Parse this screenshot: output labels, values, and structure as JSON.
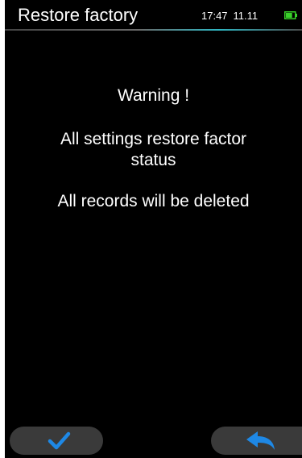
{
  "header": {
    "title": "Restore factory",
    "time": "17:47",
    "date": "11.11"
  },
  "battery": {
    "icon": "battery-icon",
    "color": "#39d12a",
    "level": 0.7
  },
  "message": {
    "warning": "Warning !",
    "line1": "All settings restore factor",
    "line2": "status",
    "line3": "All records will be deleted"
  },
  "buttons": {
    "confirm_icon": "checkmark-icon",
    "back_icon": "back-arrow-icon",
    "icon_color": "#1e88e5"
  },
  "colors": {
    "background": "#000000",
    "header_accent": "#2fb6c2",
    "button_bg": "#3a3a3a",
    "text": "#ffffff"
  }
}
